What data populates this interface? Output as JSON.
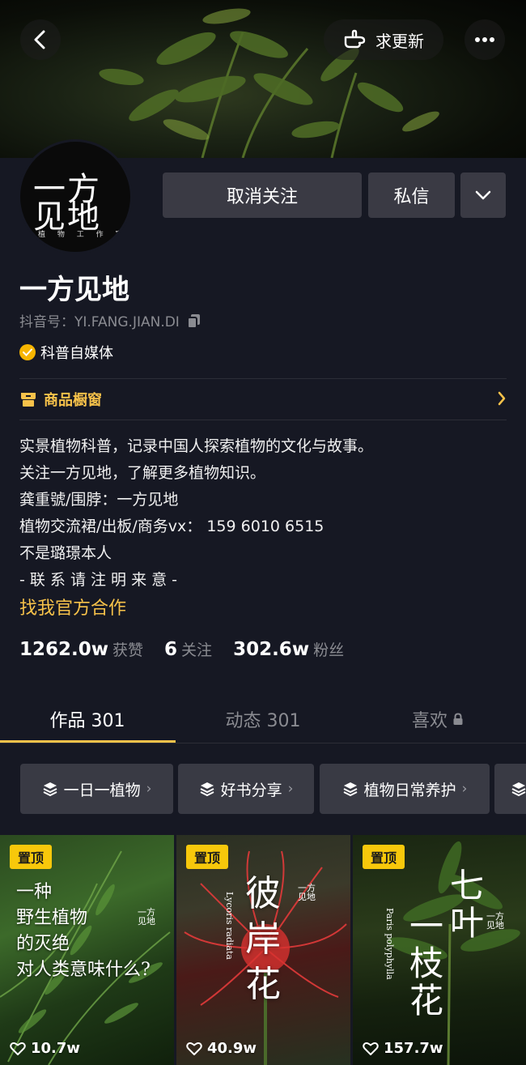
{
  "header": {
    "urge_label": "求更新"
  },
  "avatar": {
    "line1": "一方",
    "line2": "见地",
    "small": "植 物 工 作 室"
  },
  "actions": {
    "unfollow_label": "取消关注",
    "message_label": "私信"
  },
  "profile": {
    "name": "一方见地",
    "douyin_id": "抖音号：YI.FANG.JIAN.DI",
    "verification": "科普自媒体",
    "shop_label": "商品橱窗",
    "bio": [
      "实景植物科普，记录中国人探索植物的文化与故事。",
      "关注一方见地，了解更多植物知识。",
      "龚重號/围脖：一方见地",
      "植物交流裙/出板/商务vx： 159 6010 6515",
      "不是璐璟本人",
      "- 联 系 请 注 明 来 意 -"
    ],
    "collab_link": "找我官方合作"
  },
  "stats": {
    "likes_value": "1262.0w",
    "likes_label": "获赞",
    "following_value": "6",
    "following_label": "关注",
    "followers_value": "302.6w",
    "followers_label": "粉丝"
  },
  "tabs": {
    "works": "作品 301",
    "dynamics": "动态 301",
    "favorites": "喜欢"
  },
  "collections": [
    {
      "label": "一日一植物",
      "arrow": "›"
    },
    {
      "label": "好书分享",
      "arrow": "›"
    },
    {
      "label": "植物日常养护",
      "arrow": "›"
    }
  ],
  "videos": [
    {
      "pin": "置顶",
      "title_lines": [
        "一种",
        "野生植物",
        "的灭绝",
        "对人类意味什么?"
      ],
      "likes": "10.7w"
    },
    {
      "pin": "置顶",
      "title": "彼岸花",
      "latin": "Lycoris radiata",
      "likes": "40.9w"
    },
    {
      "pin": "置顶",
      "title1": "一枝花",
      "title2": "七叶",
      "latin": "Paris polyphylla",
      "likes": "157.7w"
    }
  ],
  "colors": {
    "background": "#161823",
    "accent_gold": "#f7c24a",
    "pin_yellow": "#f7c80b",
    "button_gray": "#3a3a44"
  }
}
